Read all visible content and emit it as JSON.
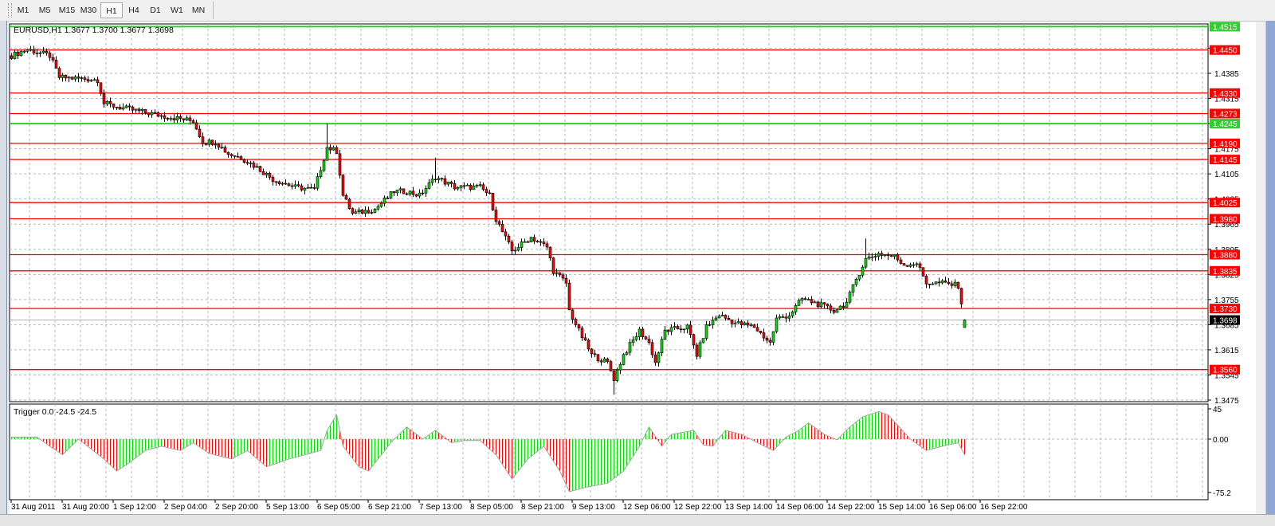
{
  "toolbar": {
    "timeframes": [
      "M1",
      "M5",
      "M15",
      "M30",
      "H1",
      "H4",
      "D1",
      "W1",
      "MN"
    ],
    "active": "H1"
  },
  "chart": {
    "symbol_info": "EURUSD,H1  1.3677 1.3700 1.3677 1.3698",
    "bid_label": "1.3698",
    "indicator_label": "Trigger 0.0 -24.5 -24.5"
  },
  "colors": {
    "bull": "#00e000",
    "bear": "#ff0000",
    "level_red": "#ff0000",
    "level_green": "#33cc33",
    "grid": "#b8b8b8",
    "bid_line": "#b0b0b0"
  },
  "chart_data": [
    {
      "type": "candlestick",
      "title": "EURUSD,H1",
      "price_ticks": [
        "1.4455",
        "1.4385",
        "1.4315",
        "1.4245",
        "1.4175",
        "1.4105",
        "1.4035",
        "1.3965",
        "1.3895",
        "1.3825",
        "1.3755",
        "1.3685",
        "1.3615",
        "1.3545",
        "1.3475"
      ],
      "ylim": [
        1.3462,
        1.4525
      ],
      "time_labels": [
        "31 Aug 2011",
        "31 Aug 20:00",
        "1 Sep 12:00",
        "2 Sep 04:00",
        "2 Sep 20:00",
        "5 Sep 13:00",
        "6 Sep 05:00",
        "6 Sep 21:00",
        "7 Sep 13:00",
        "8 Sep 05:00",
        "8 Sep 21:00",
        "9 Sep 13:00",
        "12 Sep 06:00",
        "12 Sep 22:00",
        "13 Sep 14:00",
        "14 Sep 06:00",
        "14 Sep 22:00",
        "15 Sep 14:00",
        "16 Sep 06:00",
        "16 Sep 22:00"
      ],
      "bars_per_label": 16,
      "bar_count": 300,
      "close_keypoints": [
        [
          0,
          1.4434
        ],
        [
          5,
          1.4452
        ],
        [
          12,
          1.4434
        ],
        [
          15,
          1.4374
        ],
        [
          27,
          1.4367
        ],
        [
          29,
          1.4301
        ],
        [
          34,
          1.429
        ],
        [
          47,
          1.4267
        ],
        [
          57,
          1.4252
        ],
        [
          60,
          1.4194
        ],
        [
          64,
          1.4194
        ],
        [
          68,
          1.4161
        ],
        [
          72,
          1.415
        ],
        [
          77,
          1.4123
        ],
        [
          82,
          1.409
        ],
        [
          89,
          1.4068
        ],
        [
          95,
          1.4061
        ],
        [
          99,
          1.4179
        ],
        [
          102,
          1.4168
        ],
        [
          104,
          1.4045
        ],
        [
          107,
          1.3994
        ],
        [
          114,
          1.4007
        ],
        [
          120,
          1.4056
        ],
        [
          124,
          1.4056
        ],
        [
          128,
          1.4045
        ],
        [
          133,
          1.4096
        ],
        [
          139,
          1.4068
        ],
        [
          147,
          1.4068
        ],
        [
          150,
          1.4045
        ],
        [
          152,
          1.3979
        ],
        [
          157,
          1.389
        ],
        [
          163,
          1.3928
        ],
        [
          168,
          1.3901
        ],
        [
          170,
          1.3835
        ],
        [
          174,
          1.3801
        ],
        [
          175,
          1.3724
        ],
        [
          178,
          1.3668
        ],
        [
          182,
          1.3601
        ],
        [
          187,
          1.3579
        ],
        [
          189,
          1.3535
        ],
        [
          192,
          1.3601
        ],
        [
          197,
          1.3668
        ],
        [
          200,
          1.3634
        ],
        [
          202,
          1.3579
        ],
        [
          205,
          1.3668
        ],
        [
          212,
          1.3679
        ],
        [
          215,
          1.3601
        ],
        [
          218,
          1.3679
        ],
        [
          222,
          1.3712
        ],
        [
          227,
          1.369
        ],
        [
          233,
          1.3679
        ],
        [
          238,
          1.3634
        ],
        [
          240,
          1.3701
        ],
        [
          244,
          1.3712
        ],
        [
          248,
          1.3757
        ],
        [
          252,
          1.3746
        ],
        [
          258,
          1.3724
        ],
        [
          262,
          1.3746
        ],
        [
          265,
          1.3812
        ],
        [
          268,
          1.3868
        ],
        [
          272,
          1.3883
        ],
        [
          277,
          1.3874
        ],
        [
          280,
          1.3852
        ],
        [
          284,
          1.3857
        ],
        [
          287,
          1.3801
        ],
        [
          292,
          1.3801
        ],
        [
          297,
          1.3794
        ],
        [
          299,
          1.3698
        ]
      ],
      "wick_extremes": [
        [
          99,
          1.4245
        ],
        [
          189,
          1.349
        ],
        [
          268,
          1.3925
        ],
        [
          133,
          1.415
        ]
      ],
      "levels": [
        {
          "price": "1.4515",
          "color": "green"
        },
        {
          "price": "1.4450",
          "color": "red"
        },
        {
          "price": "1.4330",
          "color": "red"
        },
        {
          "price": "1.4273",
          "color": "red"
        },
        {
          "price": "1.4245",
          "color": "green"
        },
        {
          "price": "1.4190",
          "color": "red"
        },
        {
          "price": "1.4145",
          "color": "red"
        },
        {
          "price": "1.4025",
          "color": "red"
        },
        {
          "price": "1.3980",
          "color": "red"
        },
        {
          "price": "1.3880",
          "color": "red"
        },
        {
          "price": "1.3835",
          "color": "red"
        },
        {
          "price": "1.3730",
          "color": "red"
        },
        {
          "price": "1.3560",
          "color": "red"
        }
      ],
      "bid": 1.3698
    },
    {
      "type": "histogram",
      "title": "Trigger",
      "y_ticks": [
        "45",
        "0.00",
        "-75.2"
      ],
      "ylim": [
        -75.2,
        45
      ],
      "value_keypoints": [
        [
          0,
          3
        ],
        [
          8,
          3
        ],
        [
          12,
          -10
        ],
        [
          16,
          -22
        ],
        [
          21,
          0
        ],
        [
          29,
          -28
        ],
        [
          33,
          -45
        ],
        [
          37,
          -33
        ],
        [
          42,
          -16
        ],
        [
          47,
          -10
        ],
        [
          53,
          -16
        ],
        [
          57,
          -5
        ],
        [
          62,
          -20
        ],
        [
          69,
          -28
        ],
        [
          74,
          -16
        ],
        [
          80,
          -39
        ],
        [
          87,
          -28
        ],
        [
          92,
          -22
        ],
        [
          97,
          -16
        ],
        [
          99,
          13
        ],
        [
          102,
          36
        ],
        [
          104,
          -10
        ],
        [
          109,
          -39
        ],
        [
          112,
          -45
        ],
        [
          119,
          -5
        ],
        [
          124,
          18
        ],
        [
          129,
          0
        ],
        [
          133,
          13
        ],
        [
          138,
          -5
        ],
        [
          142,
          -2
        ],
        [
          147,
          -2
        ],
        [
          152,
          -22
        ],
        [
          157,
          -56
        ],
        [
          162,
          -28
        ],
        [
          167,
          -10
        ],
        [
          172,
          -45
        ],
        [
          175,
          -74
        ],
        [
          180,
          -68
        ],
        [
          187,
          -62
        ],
        [
          192,
          -45
        ],
        [
          197,
          -10
        ],
        [
          200,
          18
        ],
        [
          204,
          -10
        ],
        [
          207,
          7
        ],
        [
          214,
          13
        ],
        [
          217,
          -8
        ],
        [
          220,
          -10
        ],
        [
          224,
          13
        ],
        [
          229,
          7
        ],
        [
          234,
          -5
        ],
        [
          239,
          -16
        ],
        [
          243,
          3
        ],
        [
          247,
          13
        ],
        [
          250,
          24
        ],
        [
          255,
          7
        ],
        [
          259,
          -1
        ],
        [
          263,
          18
        ],
        [
          267,
          33
        ],
        [
          272,
          41
        ],
        [
          275,
          36
        ],
        [
          282,
          0
        ],
        [
          287,
          -16
        ],
        [
          292,
          -10
        ],
        [
          297,
          -5
        ],
        [
          299,
          -22
        ]
      ]
    }
  ]
}
